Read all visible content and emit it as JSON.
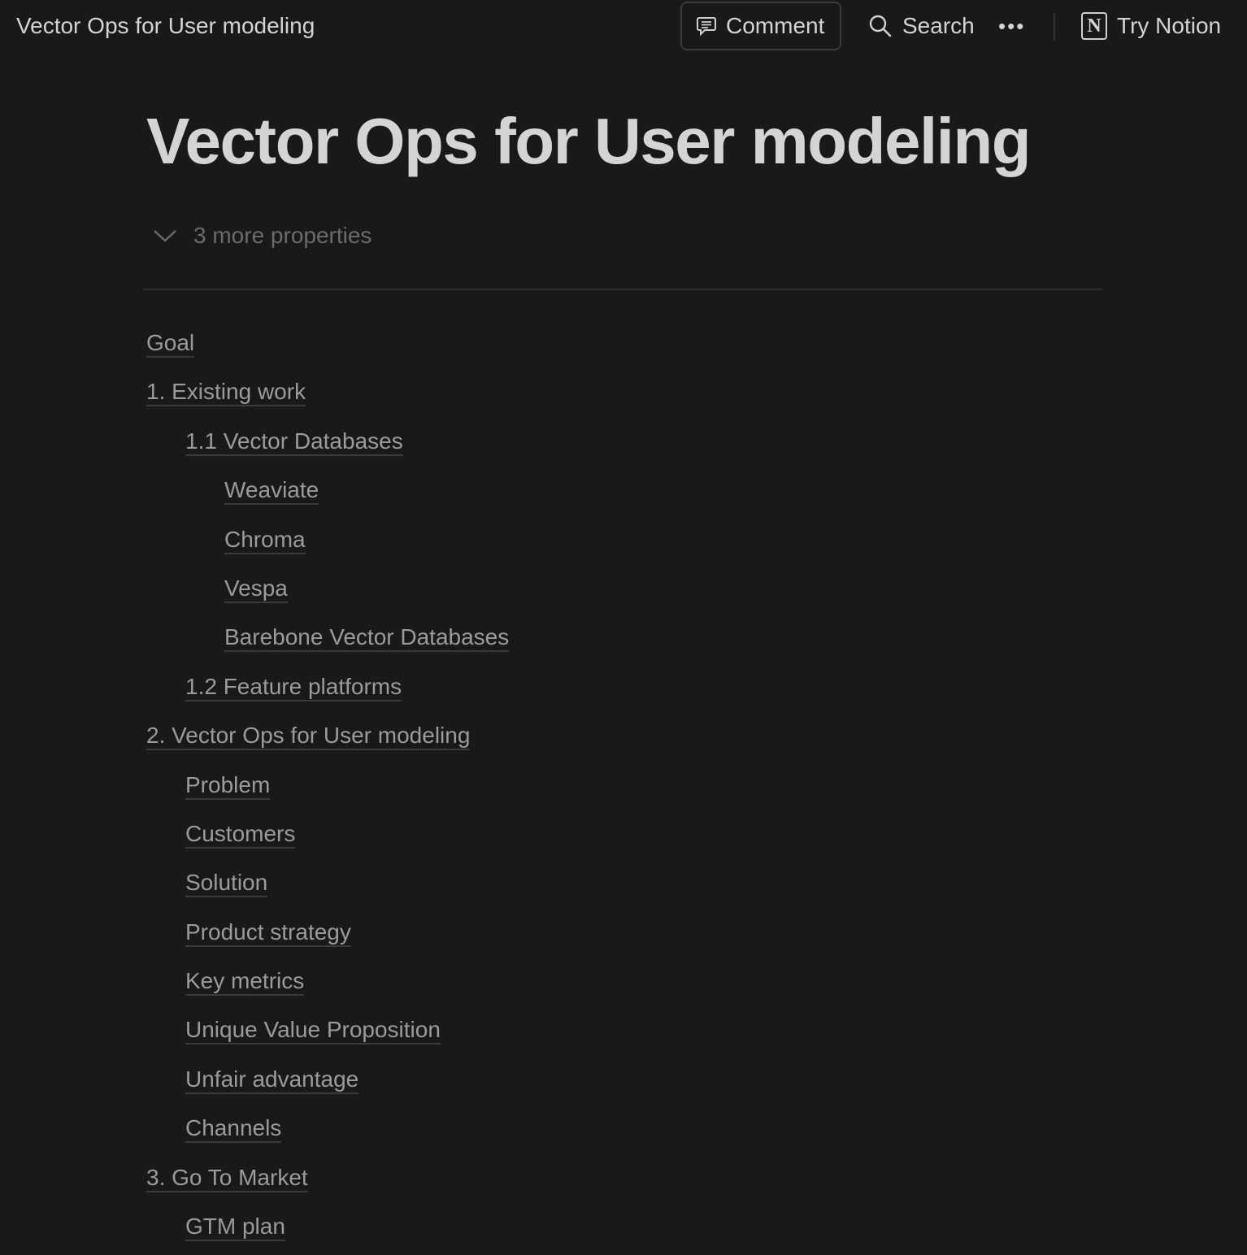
{
  "header": {
    "breadcrumb": "Vector Ops for User modeling",
    "comment_label": "Comment",
    "search_label": "Search",
    "more_label": "•••",
    "try_notion_label": "Try Notion",
    "notion_logo": "N"
  },
  "page": {
    "title": "Vector Ops for User modeling",
    "properties_toggle": "3 more properties"
  },
  "toc": [
    {
      "label": "Goal",
      "level": 0
    },
    {
      "label": "1. Existing work",
      "level": 0
    },
    {
      "label": "1.1 Vector Databases",
      "level": 1
    },
    {
      "label": "Weaviate",
      "level": 2
    },
    {
      "label": "Chroma",
      "level": 2
    },
    {
      "label": "Vespa",
      "level": 2
    },
    {
      "label": "Barebone Vector Databases",
      "level": 2
    },
    {
      "label": "1.2 Feature platforms",
      "level": 1
    },
    {
      "label": "2. Vector Ops for User modeling",
      "level": 0
    },
    {
      "label": "Problem",
      "level": 1
    },
    {
      "label": "Customers",
      "level": 1
    },
    {
      "label": "Solution",
      "level": 1
    },
    {
      "label": "Product strategy",
      "level": 1
    },
    {
      "label": "Key metrics",
      "level": 1
    },
    {
      "label": "Unique Value Proposition",
      "level": 1
    },
    {
      "label": "Unfair advantage",
      "level": 1
    },
    {
      "label": "Channels",
      "level": 1
    },
    {
      "label": "3. Go To Market",
      "level": 0
    },
    {
      "label": "GTM plan",
      "level": 1
    }
  ]
}
